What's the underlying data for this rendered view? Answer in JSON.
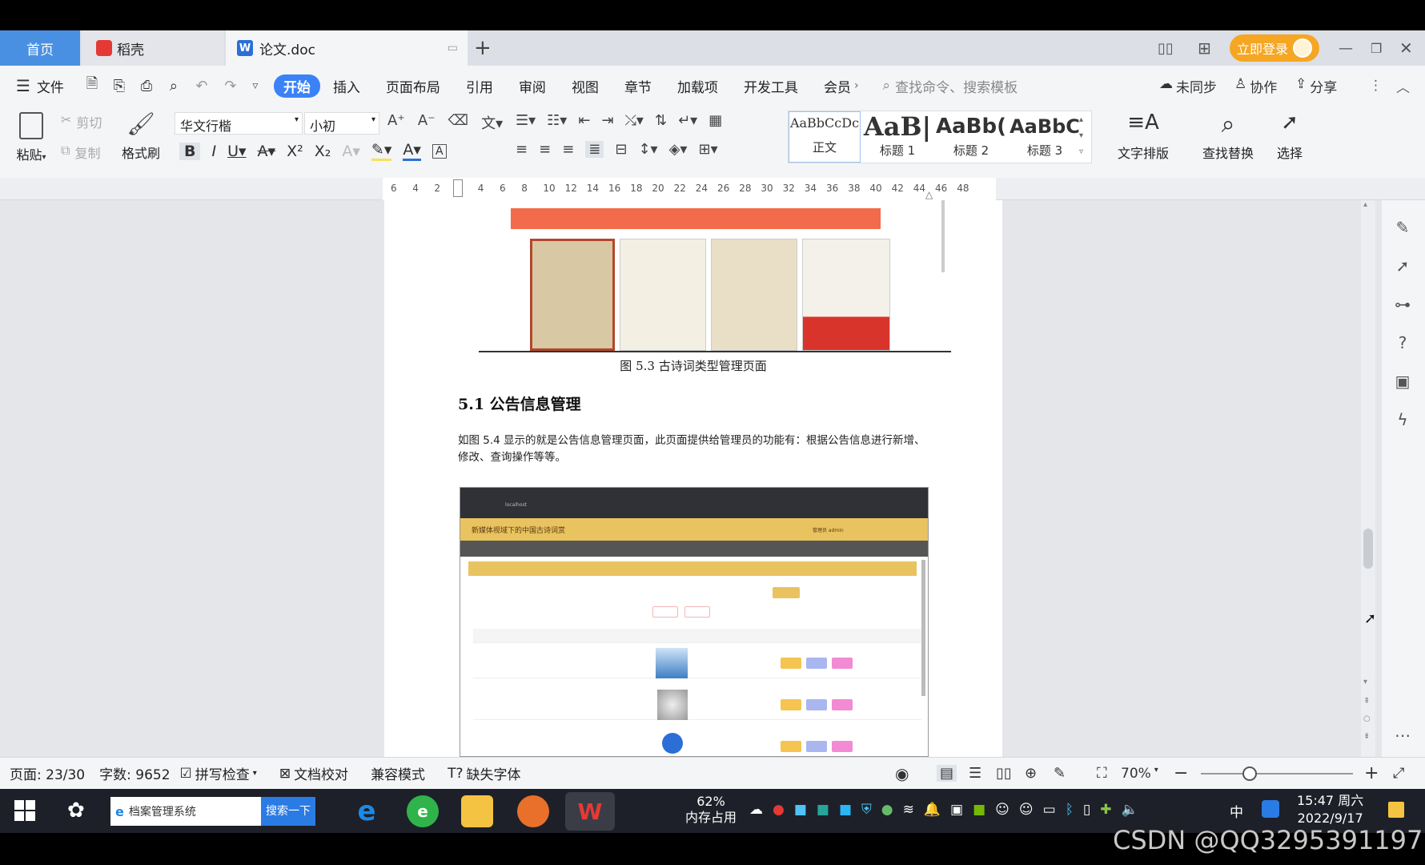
{
  "tabs": {
    "home": "首页",
    "daoke": "稻壳",
    "doc": "论文.doc",
    "new_tab": "+",
    "login": "立即登录"
  },
  "menu": {
    "file": "文件",
    "items": [
      "开始",
      "插入",
      "页面布局",
      "引用",
      "审阅",
      "视图",
      "章节",
      "加载项",
      "开发工具",
      "会员"
    ],
    "search_placeholder": "查找命令、搜索模板",
    "sync": "未同步",
    "collab": "协作",
    "share": "分享"
  },
  "ribbon": {
    "paste": "粘贴",
    "cut": "剪切",
    "copy": "复制",
    "format_painter": "格式刷",
    "font_name": "华文行楷",
    "font_size": "小初",
    "styles": [
      {
        "preview": "AaBbCcDc",
        "name": "正文"
      },
      {
        "preview": "AaB|",
        "name": "标题 1"
      },
      {
        "preview": "AaBb(",
        "name": "标题 2"
      },
      {
        "preview": "AaBbC",
        "name": "标题 3"
      }
    ],
    "text_layout": "文字排版",
    "find_replace": "查找替换",
    "select": "选择"
  },
  "ruler": {
    "ticks": [
      "6",
      "4",
      "2",
      "2",
      "4",
      "6",
      "8",
      "10",
      "12",
      "14",
      "16",
      "18",
      "20",
      "22",
      "24",
      "26",
      "28",
      "30",
      "32",
      "34",
      "36",
      "38",
      "40",
      "42",
      "44",
      "46",
      "48"
    ]
  },
  "document": {
    "figure_caption": "图 5.3  古诗词类型管理页面",
    "section_heading": "5.1 公告信息管理",
    "paragraph": "如图 5.4 显示的就是公告信息管理页面，此页面提供给管理员的功能有：根据公告信息进行新增、修改、查询操作等等。",
    "embedded_title": "新媒体视域下的中国古诗词赏",
    "embedded_url": "localhost",
    "embedded_user": "管理员 admin"
  },
  "status": {
    "page": "页面: 23/30",
    "words": "字数: 9652",
    "spell": "拼写检查",
    "proof": "文档校对",
    "compat": "兼容模式",
    "missing_font": "缺失字体",
    "zoom": "70%"
  },
  "taskbar": {
    "search_text": "档案管理系统",
    "search_button": "搜索一下",
    "memory_pct": "62%",
    "memory_label": "内存占用",
    "ime": "中",
    "time": "15:47 周六",
    "date": "2022/9/17"
  },
  "watermark": "CSDN @QQ3295391197",
  "colors": {
    "active_tab": "#3b82f6",
    "login_btn": "#f5a623",
    "orange_banner": "#f26b4a",
    "embedded_header": "#e8c35f",
    "taskbar": "#1d2028"
  }
}
